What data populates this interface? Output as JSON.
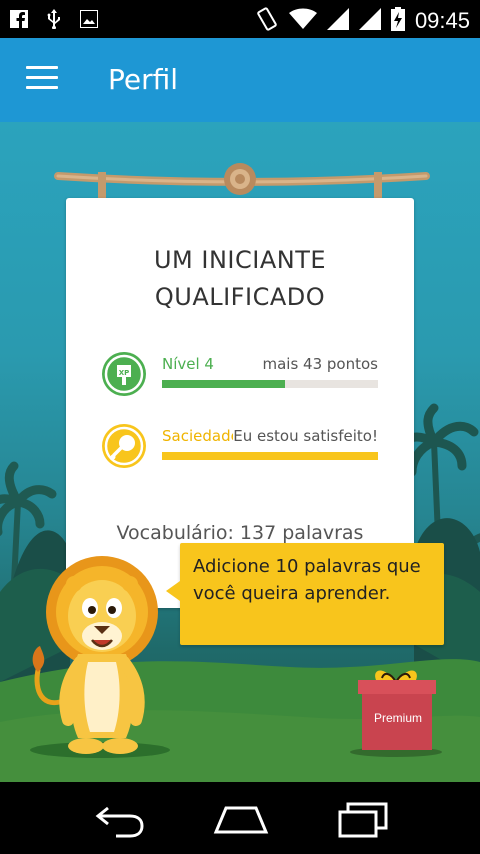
{
  "status_bar": {
    "time": "09:45",
    "left_icons": [
      "facebook-icon",
      "usb-icon",
      "image-icon"
    ],
    "right_icons": [
      "vibrate-icon",
      "wifi-icon",
      "signal-icon",
      "signal-icon",
      "battery-charging-icon"
    ]
  },
  "app_bar": {
    "title": "Perfil",
    "color": "#1e97d4"
  },
  "profile": {
    "rank_title": "UM INICIANTE QUALIFICADO",
    "level": {
      "label": "Nível 4",
      "value": "mais 43 pontos",
      "progress": 0.57,
      "color": "#4caf50",
      "icon": "xp-badge-icon"
    },
    "satiety": {
      "label": "Saciedade",
      "value": "Eu estou satisfeito!",
      "progress": 1.0,
      "color": "#f8c51c",
      "icon": "meat-icon"
    },
    "vocabulary": "Vocabulário: 137 palavras"
  },
  "mascot": {
    "speech": "Adicione 10 palavras que você queira aprender."
  },
  "premium": {
    "label": "Premium"
  },
  "nav_bar": {
    "icons": [
      "back-icon",
      "home-icon",
      "recents-icon"
    ]
  }
}
